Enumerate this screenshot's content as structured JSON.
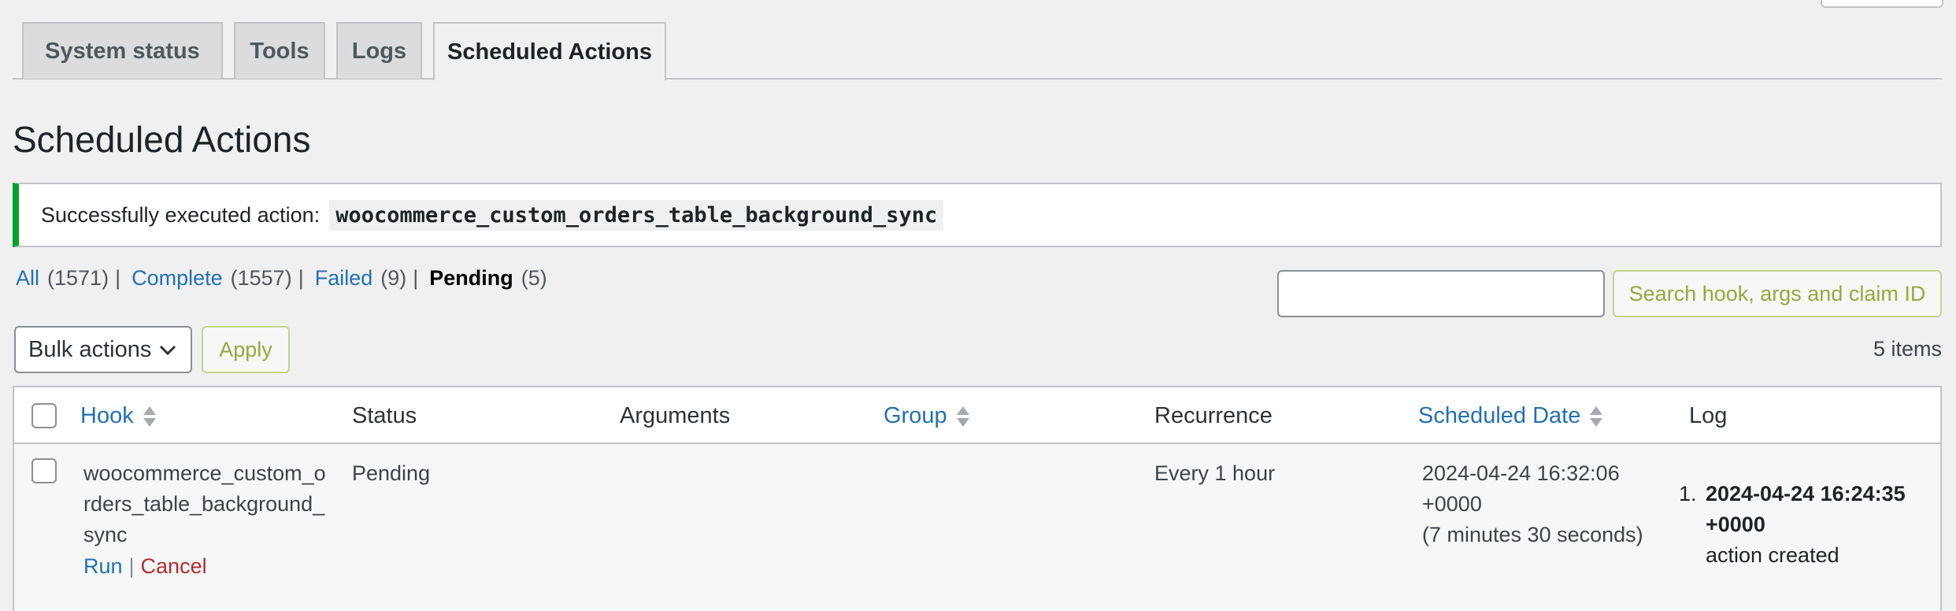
{
  "tabs": [
    {
      "label": "System status",
      "active": false
    },
    {
      "label": "Tools",
      "active": false
    },
    {
      "label": "Logs",
      "active": false
    },
    {
      "label": "Scheduled Actions",
      "active": true
    }
  ],
  "page_title": "Scheduled Actions",
  "notice": {
    "text": "Successfully executed action:",
    "code": "woocommerce_custom_orders_table_background_sync",
    "color": "#00a32a"
  },
  "filters": [
    {
      "label": "All",
      "count": "(1571)",
      "current": false
    },
    {
      "label": "Complete",
      "count": "(1557)",
      "current": false
    },
    {
      "label": "Failed",
      "count": "(9)",
      "current": false
    },
    {
      "label": "Pending",
      "count": "(5)",
      "current": true
    }
  ],
  "search": {
    "value": "",
    "button_label": "Search hook, args and claim ID"
  },
  "bulk": {
    "selected": "Bulk actions",
    "apply_label": "Apply"
  },
  "items_count": "5 items",
  "table": {
    "columns": [
      {
        "label": "Hook",
        "sortable": true
      },
      {
        "label": "Status",
        "sortable": false
      },
      {
        "label": "Arguments",
        "sortable": false
      },
      {
        "label": "Group",
        "sortable": true
      },
      {
        "label": "Recurrence",
        "sortable": false
      },
      {
        "label": "Scheduled Date",
        "sortable": true
      },
      {
        "label": "Log",
        "sortable": false
      }
    ],
    "rows": [
      {
        "hook": "woocommerce_custom_orders_table_background_sync",
        "actions": {
          "run": "Run",
          "sep": "|",
          "cancel": "Cancel"
        },
        "status": "Pending",
        "arguments": "",
        "group": "",
        "recurrence": "Every 1 hour",
        "scheduled_date": "2024-04-24 16:32:06 +0000",
        "scheduled_relative": "(7 minutes 30 seconds)",
        "log": [
          {
            "number": "1.",
            "date": "2024-04-24 16:24:35 +0000",
            "message": "action created"
          }
        ]
      }
    ]
  },
  "colors": {
    "link": "#2271b1",
    "danger": "#b32d2e",
    "success": "#00a32a"
  }
}
